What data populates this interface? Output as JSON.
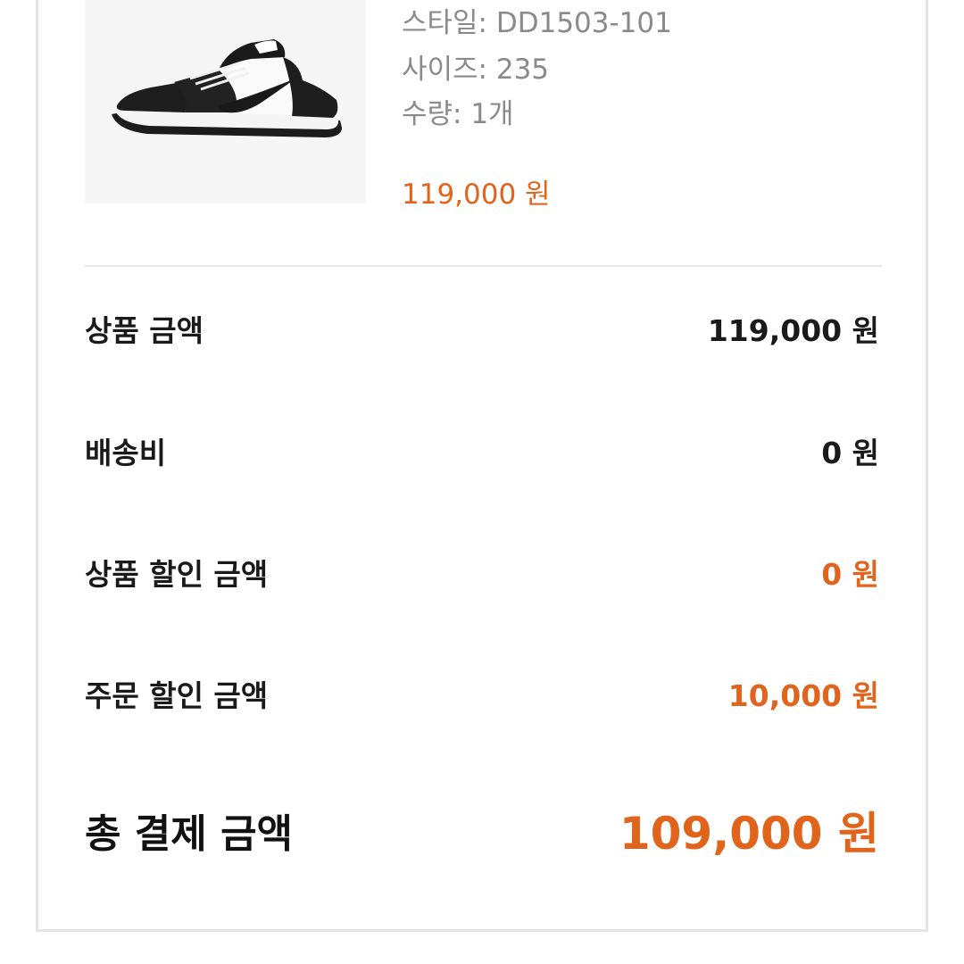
{
  "product": {
    "image_icon": "sneaker-image",
    "style_line": "스타일: DD1503-101",
    "size_line": "사이즈: 235",
    "quantity_line": "수량: 1개",
    "price": "119,000 원"
  },
  "summary": {
    "product_amount": {
      "label": "상품 금액",
      "value": "119,000 원"
    },
    "shipping_fee": {
      "label": "배송비",
      "value": "0 원"
    },
    "product_discount": {
      "label": "상품 할인 금액",
      "value": "0 원"
    },
    "order_discount": {
      "label": "주문 할인 금액",
      "value": "10,000 원"
    },
    "total": {
      "label": "총 결제 금액",
      "value": "109,000 원"
    }
  },
  "colors": {
    "accent": "#e0641c",
    "text": "#1a1a1a",
    "muted": "#8a8a8a",
    "divider": "#e6e6e6"
  }
}
